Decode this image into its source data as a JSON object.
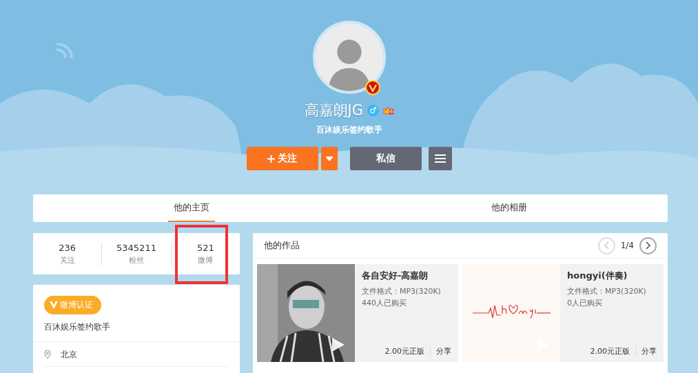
{
  "profile": {
    "name": "高嘉朗JG",
    "gender_symbol": "♂",
    "vip_level": "6",
    "verified": true,
    "bio": "百沐娱乐签约歌手"
  },
  "actions": {
    "follow": "关注",
    "message": "私信"
  },
  "tabs": [
    {
      "label": "他的主页",
      "selected": true
    },
    {
      "label": "他的相册",
      "selected": false
    }
  ],
  "stats": [
    {
      "value": "236",
      "label": "关注",
      "highlighted": false
    },
    {
      "value": "5345211",
      "label": "粉丝",
      "highlighted": false
    },
    {
      "value": "521",
      "label": "微博",
      "highlighted": true
    }
  ],
  "info": {
    "badge": "微博认证",
    "description": "百沐娱乐签约歌手",
    "location": "北京"
  },
  "works": {
    "title": "他的作品",
    "page": "1/4",
    "prev_disabled": true,
    "items": [
      {
        "title": "各自安好-高嘉朗",
        "format": "文件格式：MP3(320K)",
        "buyers": "440人已购买",
        "price": "2.00元正版",
        "share": "分享",
        "kind": "portrait"
      },
      {
        "title": "hongyi(伴奏)",
        "format": "文件格式：MP3(320K)",
        "buyers": "0人已购买",
        "price": "2.00元正版",
        "share": "分享",
        "kind": "heartbeat"
      }
    ]
  }
}
